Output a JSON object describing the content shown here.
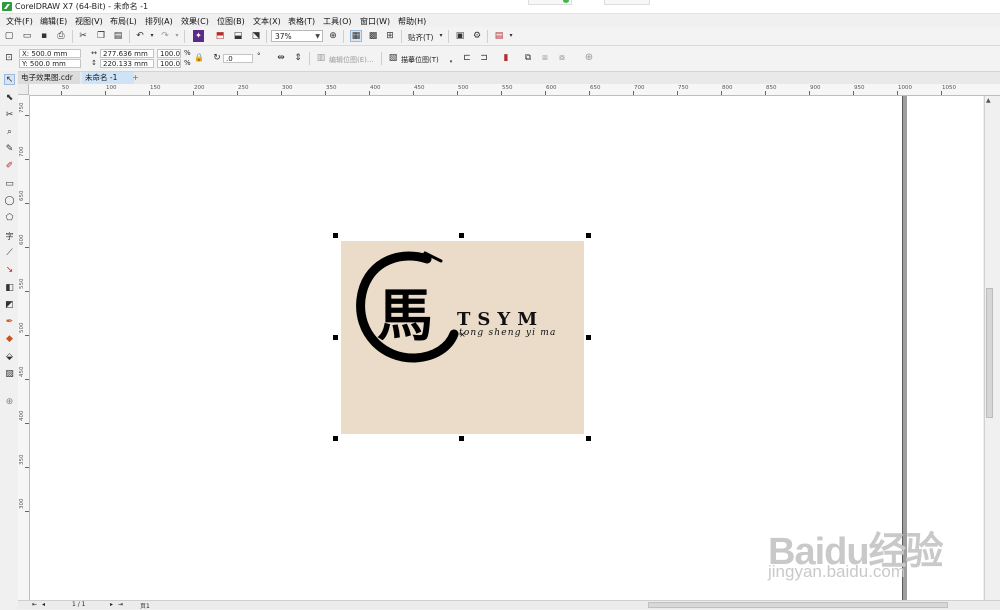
{
  "window": {
    "title": "CorelDRAW X7 (64-Bit) - 未命名 -1"
  },
  "menu": [
    "文件(F)",
    "编辑(E)",
    "视图(V)",
    "布局(L)",
    "排列(A)",
    "效果(C)",
    "位图(B)",
    "文本(X)",
    "表格(T)",
    "工具(O)",
    "窗口(W)",
    "帮助(H)"
  ],
  "toolbar": {
    "zoom": "37%",
    "snap": "贴齐(T)"
  },
  "property_bar": {
    "x": "X: 500.0 mm",
    "y": "Y: 500.0 mm",
    "width": "277.636 mm",
    "height": "220.133 mm",
    "scale_w": "100.0",
    "scale_h": "100.0",
    "percent": "%",
    "angle": ".0",
    "degree": "°",
    "edit_bitmap": "编辑位图(E)...",
    "trace_bitmap": "描摹位图(T)"
  },
  "tabs": [
    "电子效果图.cdr",
    "未命名 -1"
  ],
  "ruler_h": [
    "50",
    "100",
    "150",
    "200",
    "250",
    "300",
    "350",
    "400",
    "450",
    "500",
    "550",
    "600",
    "650",
    "700",
    "750",
    "800",
    "850",
    "900",
    "950",
    "1000",
    "1050"
  ],
  "ruler_v": [
    "750",
    "700",
    "650",
    "600",
    "550",
    "500",
    "450",
    "400",
    "350",
    "300"
  ],
  "logo": {
    "mark": "馬",
    "letters": "TSYM",
    "tagline": "tong sheng yi ma"
  },
  "status": {
    "page_count": "1 / 1",
    "page_tab": "页1"
  },
  "watermark": {
    "brand": "Baidu经验",
    "url": "jingyan.baidu.com"
  },
  "colors": {
    "image_bg": "#eadcc9",
    "tab_active": "#cfe3f7",
    "logo_green": "#2e9c3b"
  }
}
